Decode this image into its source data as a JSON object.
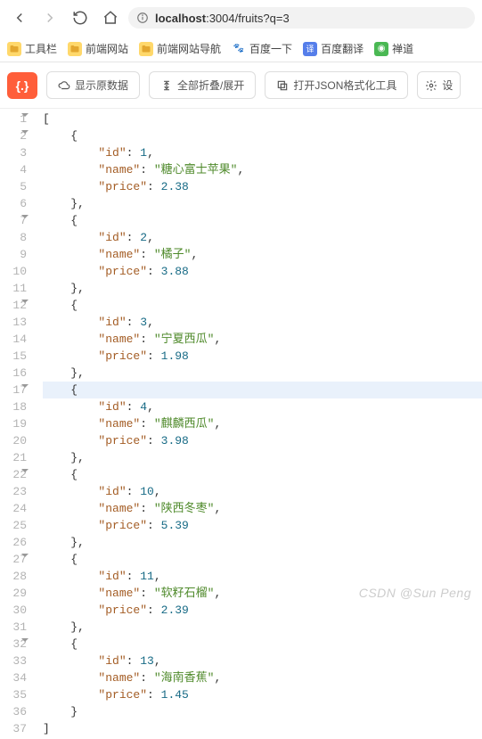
{
  "nav": {
    "url_host": "localhost",
    "url_rest": ":3004/fruits?q=3"
  },
  "bookmarks": [
    {
      "label": "工具栏",
      "type": "folder"
    },
    {
      "label": "前端网站",
      "type": "folder"
    },
    {
      "label": "前端网站导航",
      "type": "folder"
    },
    {
      "label": "百度一下",
      "type": "baidu"
    },
    {
      "label": "百度翻译",
      "type": "translate"
    },
    {
      "label": "禅道",
      "type": "green"
    }
  ],
  "toolbar": {
    "logo": "{.}",
    "raw": "显示原数据",
    "collapse": "全部折叠/展开",
    "open_tool": "打开JSON格式化工具",
    "settings": "设"
  },
  "lines": [
    {
      "n": 1,
      "fold": true,
      "indent": 0,
      "tokens": [
        {
          "t": "p",
          "v": "["
        }
      ]
    },
    {
      "n": 2,
      "fold": true,
      "indent": 1,
      "tokens": [
        {
          "t": "p",
          "v": "{"
        }
      ]
    },
    {
      "n": 3,
      "indent": 2,
      "tokens": [
        {
          "t": "key",
          "v": "\"id\""
        },
        {
          "t": "p",
          "v": ": "
        },
        {
          "t": "num",
          "v": "1"
        },
        {
          "t": "p",
          "v": ","
        }
      ]
    },
    {
      "n": 4,
      "indent": 2,
      "tokens": [
        {
          "t": "key",
          "v": "\"name\""
        },
        {
          "t": "p",
          "v": ": "
        },
        {
          "t": "str",
          "v": "\"糖心富士苹果\""
        },
        {
          "t": "p",
          "v": ","
        }
      ]
    },
    {
      "n": 5,
      "indent": 2,
      "tokens": [
        {
          "t": "key",
          "v": "\"price\""
        },
        {
          "t": "p",
          "v": ": "
        },
        {
          "t": "num",
          "v": "2.38"
        }
      ]
    },
    {
      "n": 6,
      "indent": 1,
      "tokens": [
        {
          "t": "p",
          "v": "},"
        }
      ]
    },
    {
      "n": 7,
      "fold": true,
      "indent": 1,
      "tokens": [
        {
          "t": "p",
          "v": "{"
        }
      ]
    },
    {
      "n": 8,
      "indent": 2,
      "tokens": [
        {
          "t": "key",
          "v": "\"id\""
        },
        {
          "t": "p",
          "v": ": "
        },
        {
          "t": "num",
          "v": "2"
        },
        {
          "t": "p",
          "v": ","
        }
      ]
    },
    {
      "n": 9,
      "indent": 2,
      "tokens": [
        {
          "t": "key",
          "v": "\"name\""
        },
        {
          "t": "p",
          "v": ": "
        },
        {
          "t": "str",
          "v": "\"橘子\""
        },
        {
          "t": "p",
          "v": ","
        }
      ]
    },
    {
      "n": 10,
      "indent": 2,
      "tokens": [
        {
          "t": "key",
          "v": "\"price\""
        },
        {
          "t": "p",
          "v": ": "
        },
        {
          "t": "num",
          "v": "3.88"
        }
      ]
    },
    {
      "n": 11,
      "indent": 1,
      "tokens": [
        {
          "t": "p",
          "v": "},"
        }
      ]
    },
    {
      "n": 12,
      "fold": true,
      "indent": 1,
      "tokens": [
        {
          "t": "p",
          "v": "{"
        }
      ]
    },
    {
      "n": 13,
      "indent": 2,
      "tokens": [
        {
          "t": "key",
          "v": "\"id\""
        },
        {
          "t": "p",
          "v": ": "
        },
        {
          "t": "num",
          "v": "3"
        },
        {
          "t": "p",
          "v": ","
        }
      ]
    },
    {
      "n": 14,
      "indent": 2,
      "tokens": [
        {
          "t": "key",
          "v": "\"name\""
        },
        {
          "t": "p",
          "v": ": "
        },
        {
          "t": "str",
          "v": "\"宁夏西瓜\""
        },
        {
          "t": "p",
          "v": ","
        }
      ]
    },
    {
      "n": 15,
      "indent": 2,
      "tokens": [
        {
          "t": "key",
          "v": "\"price\""
        },
        {
          "t": "p",
          "v": ": "
        },
        {
          "t": "num",
          "v": "1.98"
        }
      ]
    },
    {
      "n": 16,
      "indent": 1,
      "tokens": [
        {
          "t": "p",
          "v": "},"
        }
      ]
    },
    {
      "n": 17,
      "fold": true,
      "indent": 1,
      "hl": true,
      "tokens": [
        {
          "t": "p",
          "v": "{"
        }
      ]
    },
    {
      "n": 18,
      "indent": 2,
      "tokens": [
        {
          "t": "key",
          "v": "\"id\""
        },
        {
          "t": "p",
          "v": ": "
        },
        {
          "t": "num",
          "v": "4"
        },
        {
          "t": "p",
          "v": ","
        }
      ]
    },
    {
      "n": 19,
      "indent": 2,
      "tokens": [
        {
          "t": "key",
          "v": "\"name\""
        },
        {
          "t": "p",
          "v": ": "
        },
        {
          "t": "str",
          "v": "\"麒麟西瓜\""
        },
        {
          "t": "p",
          "v": ","
        }
      ]
    },
    {
      "n": 20,
      "indent": 2,
      "tokens": [
        {
          "t": "key",
          "v": "\"price\""
        },
        {
          "t": "p",
          "v": ": "
        },
        {
          "t": "num",
          "v": "3.98"
        }
      ]
    },
    {
      "n": 21,
      "indent": 1,
      "tokens": [
        {
          "t": "p",
          "v": "},"
        }
      ]
    },
    {
      "n": 22,
      "fold": true,
      "indent": 1,
      "tokens": [
        {
          "t": "p",
          "v": "{"
        }
      ]
    },
    {
      "n": 23,
      "indent": 2,
      "tokens": [
        {
          "t": "key",
          "v": "\"id\""
        },
        {
          "t": "p",
          "v": ": "
        },
        {
          "t": "num",
          "v": "10"
        },
        {
          "t": "p",
          "v": ","
        }
      ]
    },
    {
      "n": 24,
      "indent": 2,
      "tokens": [
        {
          "t": "key",
          "v": "\"name\""
        },
        {
          "t": "p",
          "v": ": "
        },
        {
          "t": "str",
          "v": "\"陕西冬枣\""
        },
        {
          "t": "p",
          "v": ","
        }
      ]
    },
    {
      "n": 25,
      "indent": 2,
      "tokens": [
        {
          "t": "key",
          "v": "\"price\""
        },
        {
          "t": "p",
          "v": ": "
        },
        {
          "t": "num",
          "v": "5.39"
        }
      ]
    },
    {
      "n": 26,
      "indent": 1,
      "tokens": [
        {
          "t": "p",
          "v": "},"
        }
      ]
    },
    {
      "n": 27,
      "fold": true,
      "indent": 1,
      "tokens": [
        {
          "t": "p",
          "v": "{"
        }
      ]
    },
    {
      "n": 28,
      "indent": 2,
      "tokens": [
        {
          "t": "key",
          "v": "\"id\""
        },
        {
          "t": "p",
          "v": ": "
        },
        {
          "t": "num",
          "v": "11"
        },
        {
          "t": "p",
          "v": ","
        }
      ]
    },
    {
      "n": 29,
      "indent": 2,
      "tokens": [
        {
          "t": "key",
          "v": "\"name\""
        },
        {
          "t": "p",
          "v": ": "
        },
        {
          "t": "str",
          "v": "\"软籽石榴\""
        },
        {
          "t": "p",
          "v": ","
        }
      ]
    },
    {
      "n": 30,
      "indent": 2,
      "tokens": [
        {
          "t": "key",
          "v": "\"price\""
        },
        {
          "t": "p",
          "v": ": "
        },
        {
          "t": "num",
          "v": "2.39"
        }
      ]
    },
    {
      "n": 31,
      "indent": 1,
      "tokens": [
        {
          "t": "p",
          "v": "},"
        }
      ]
    },
    {
      "n": 32,
      "fold": true,
      "indent": 1,
      "tokens": [
        {
          "t": "p",
          "v": "{"
        }
      ]
    },
    {
      "n": 33,
      "indent": 2,
      "tokens": [
        {
          "t": "key",
          "v": "\"id\""
        },
        {
          "t": "p",
          "v": ": "
        },
        {
          "t": "num",
          "v": "13"
        },
        {
          "t": "p",
          "v": ","
        }
      ]
    },
    {
      "n": 34,
      "indent": 2,
      "tokens": [
        {
          "t": "key",
          "v": "\"name\""
        },
        {
          "t": "p",
          "v": ": "
        },
        {
          "t": "str",
          "v": "\"海南香蕉\""
        },
        {
          "t": "p",
          "v": ","
        }
      ]
    },
    {
      "n": 35,
      "indent": 2,
      "tokens": [
        {
          "t": "key",
          "v": "\"price\""
        },
        {
          "t": "p",
          "v": ": "
        },
        {
          "t": "num",
          "v": "1.45"
        }
      ]
    },
    {
      "n": 36,
      "indent": 1,
      "tokens": [
        {
          "t": "p",
          "v": "}"
        }
      ]
    },
    {
      "n": 37,
      "indent": 0,
      "tokens": [
        {
          "t": "p",
          "v": "]"
        }
      ]
    }
  ],
  "watermark": "CSDN @Sun  Peng"
}
